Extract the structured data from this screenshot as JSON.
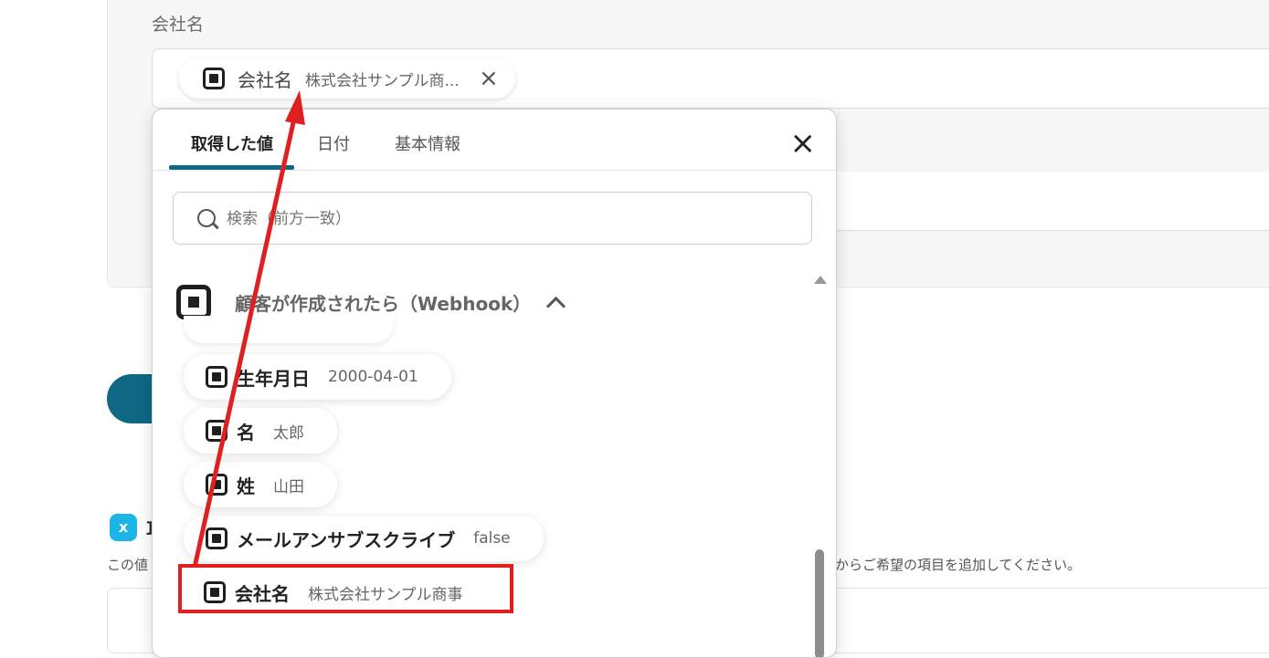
{
  "form": {
    "field_label": "会社名",
    "selected_chip": {
      "name": "会社名",
      "value": "株式会社サンプル商...",
      "remove": "×"
    }
  },
  "popup": {
    "tabs": [
      {
        "label": "取得した値",
        "active": true
      },
      {
        "label": "日付",
        "active": false
      },
      {
        "label": "基本情報",
        "active": false
      }
    ],
    "close_label": "×",
    "search": {
      "placeholder": "検索（前方一致）"
    },
    "group": {
      "title": "顧客が作成されたら（Webhook）"
    },
    "items": [
      {
        "name": "生年月日",
        "value": "2000-04-01"
      },
      {
        "name": "名",
        "value": "太郎"
      },
      {
        "name": "姓",
        "value": "山田"
      },
      {
        "name": "メールアンサブスクライブ",
        "value": "false"
      },
      {
        "name": "会社名",
        "value": "株式会社サンプル商事"
      }
    ]
  },
  "background": {
    "section_head": "耳",
    "note_left": "この値",
    "note_right": "からご希望の項目を追加してください。",
    "hex_icon": "x"
  },
  "colors": {
    "accent": "#0f6884",
    "highlight": "#e02020",
    "section_icon": "#1bb6e6"
  }
}
